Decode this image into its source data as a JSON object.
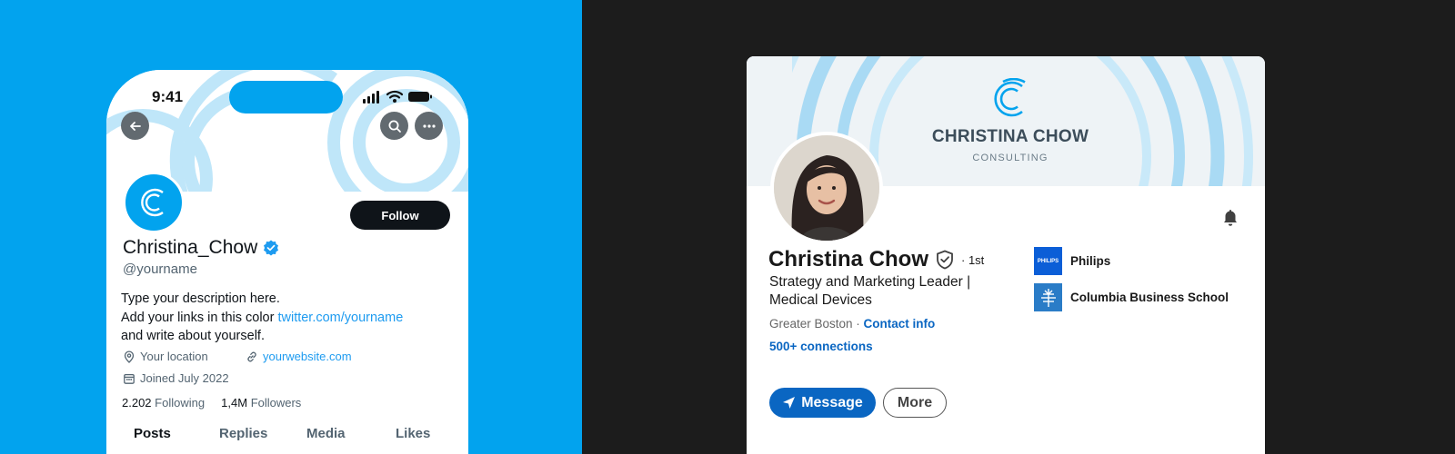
{
  "twitter": {
    "status_time": "9:41",
    "display_name": "Christina_Chow",
    "handle": "@yourname",
    "follow_label": "Follow",
    "bio_line1": "Type your description here.",
    "bio_line2_prefix": "Add your links in this color ",
    "bio_link": "twitter.com/yourname",
    "bio_line3": "and write about yourself.",
    "location": "Your location",
    "website": "yourwebsite.com",
    "joined": "Joined July 2022",
    "following_count": "2.202",
    "following_label": "Following",
    "followers_count": "1,4M",
    "followers_label": "Followers",
    "tabs": [
      "Posts",
      "Replies",
      "Media",
      "Likes"
    ]
  },
  "linkedin": {
    "brand_name": "CHRISTINA CHOW",
    "brand_sub": "CONSULTING",
    "name": "Christina Chow",
    "degree": "· 1st",
    "headline": "Strategy and Marketing Leader | Medical Devices",
    "location": "Greater Boston · ",
    "contact_info": "Contact info",
    "connections": "500+ connections",
    "message_label": "Message",
    "more_label": "More",
    "orgs": [
      {
        "name": "Philips",
        "logo_text": "PHILIPS"
      },
      {
        "name": "Columbia Business School"
      }
    ]
  },
  "colors": {
    "twitter_blue": "#02a3ee",
    "linkedin_blue": "#0a66c2",
    "dark_bg": "#1c1c1c"
  }
}
